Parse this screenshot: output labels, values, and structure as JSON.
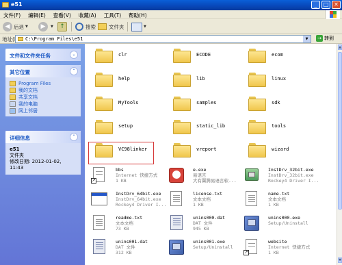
{
  "window": {
    "title": "e51"
  },
  "menu": [
    "文件(F)",
    "编辑(E)",
    "查看(V)",
    "收藏(A)",
    "工具(T)",
    "帮助(H)"
  ],
  "toolbar": {
    "back": "后退",
    "search": "搜索",
    "folders": "文件夹"
  },
  "address": {
    "label": "地址(D)",
    "path": "C:\\Program Files\\e51",
    "go": "转到"
  },
  "left_pane": {
    "tasks_title": "文件和文件夹任务",
    "places_title": "其它位置",
    "places": [
      {
        "label": "Program Files",
        "icon": "folder-icon"
      },
      {
        "label": "我的文档",
        "icon": "documents-icon"
      },
      {
        "label": "共享文档",
        "icon": "shared-documents-icon"
      },
      {
        "label": "我的电脑",
        "icon": "computer-icon"
      },
      {
        "label": "网上邻居",
        "icon": "network-icon"
      }
    ],
    "details_title": "详细信息",
    "details": {
      "name": "e51",
      "type": "文件夹",
      "modified_label": "修改日期: 2012-01-02,",
      "modified_time": "11:43"
    }
  },
  "folders": [
    "clr",
    "ECODE",
    "ecom",
    "help",
    "lib",
    "linux",
    "MyTools",
    "samples",
    "sdk",
    "setup",
    "static_lib",
    "tools",
    "VC98linker",
    "vreport",
    "wizard"
  ],
  "files": [
    {
      "name": "bbs",
      "line2": "Internet 快捷方式",
      "line3": "1 KB",
      "icon": "internet-shortcut-icon"
    },
    {
      "name": "e.exe",
      "line2": "易语言",
      "line3": "大有翼腾易语言软...",
      "icon": "e-language-app-icon"
    },
    {
      "name": "InstDrv_32bit.exe",
      "line2": "InstDrv_32bit.exe",
      "line3": "Rockey4 Driver I...",
      "icon": "installer-icon"
    },
    {
      "name": "InstDrv_64bit.exe",
      "line2": "InstDrv_64bit.exe",
      "line3": "Rockey4 Driver I...",
      "icon": "application-icon"
    },
    {
      "name": "license.txt",
      "line2": "文本文档",
      "line3": "1 KB",
      "icon": "text-document-icon"
    },
    {
      "name": "name.txt",
      "line2": "文本文档",
      "line3": "1 KB",
      "icon": "text-document-icon"
    },
    {
      "name": "readme.txt",
      "line2": "文本文档",
      "line3": "73 KB",
      "icon": "text-document-icon"
    },
    {
      "name": "unins000.dat",
      "line2": "DAT 文件",
      "line3": "945 KB",
      "icon": "dat-file-icon"
    },
    {
      "name": "unins000.exe",
      "line2": "Setup/Uninstall",
      "line3": "",
      "icon": "setup-icon"
    },
    {
      "name": "unins001.dat",
      "line2": "DAT 文件",
      "line3": "312 KB",
      "icon": "dat-file-icon"
    },
    {
      "name": "unins001.exe",
      "line2": "Setup/Uninstall",
      "line3": "",
      "icon": "setup-icon"
    },
    {
      "name": "website",
      "line2": "Internet 快捷方式",
      "line3": "1 KB",
      "icon": "internet-shortcut-icon"
    }
  ],
  "colors": {
    "title_bar": "#0a5fd8",
    "left_pane": "#7ba2e7",
    "highlight": "#d63b3b",
    "link": "#215dc6"
  }
}
